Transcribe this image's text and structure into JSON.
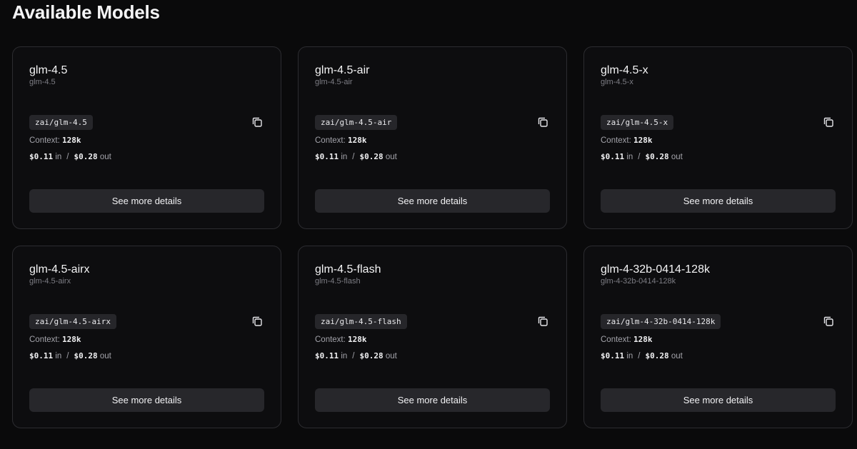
{
  "page": {
    "title": "Available Models"
  },
  "labels": {
    "context": "Context:",
    "in": "in",
    "out": "out",
    "separator": "/",
    "details_button": "See more details"
  },
  "models": [
    {
      "name": "glm-4.5",
      "subtitle": "glm-4.5",
      "id": "zai/glm-4.5",
      "context": "128k",
      "price_in": "$0.11",
      "price_out": "$0.28"
    },
    {
      "name": "glm-4.5-air",
      "subtitle": "glm-4.5-air",
      "id": "zai/glm-4.5-air",
      "context": "128k",
      "price_in": "$0.11",
      "price_out": "$0.28"
    },
    {
      "name": "glm-4.5-x",
      "subtitle": "glm-4.5-x",
      "id": "zai/glm-4.5-x",
      "context": "128k",
      "price_in": "$0.11",
      "price_out": "$0.28"
    },
    {
      "name": "glm-4.5-airx",
      "subtitle": "glm-4.5-airx",
      "id": "zai/glm-4.5-airx",
      "context": "128k",
      "price_in": "$0.11",
      "price_out": "$0.28"
    },
    {
      "name": "glm-4.5-flash",
      "subtitle": "glm-4.5-flash",
      "id": "zai/glm-4.5-flash",
      "context": "128k",
      "price_in": "$0.11",
      "price_out": "$0.28"
    },
    {
      "name": "glm-4-32b-0414-128k",
      "subtitle": "glm-4-32b-0414-128k",
      "id": "zai/glm-4-32b-0414-128k",
      "context": "128k",
      "price_in": "$0.11",
      "price_out": "$0.28"
    }
  ],
  "icons": {
    "copy": "copy-icon"
  }
}
